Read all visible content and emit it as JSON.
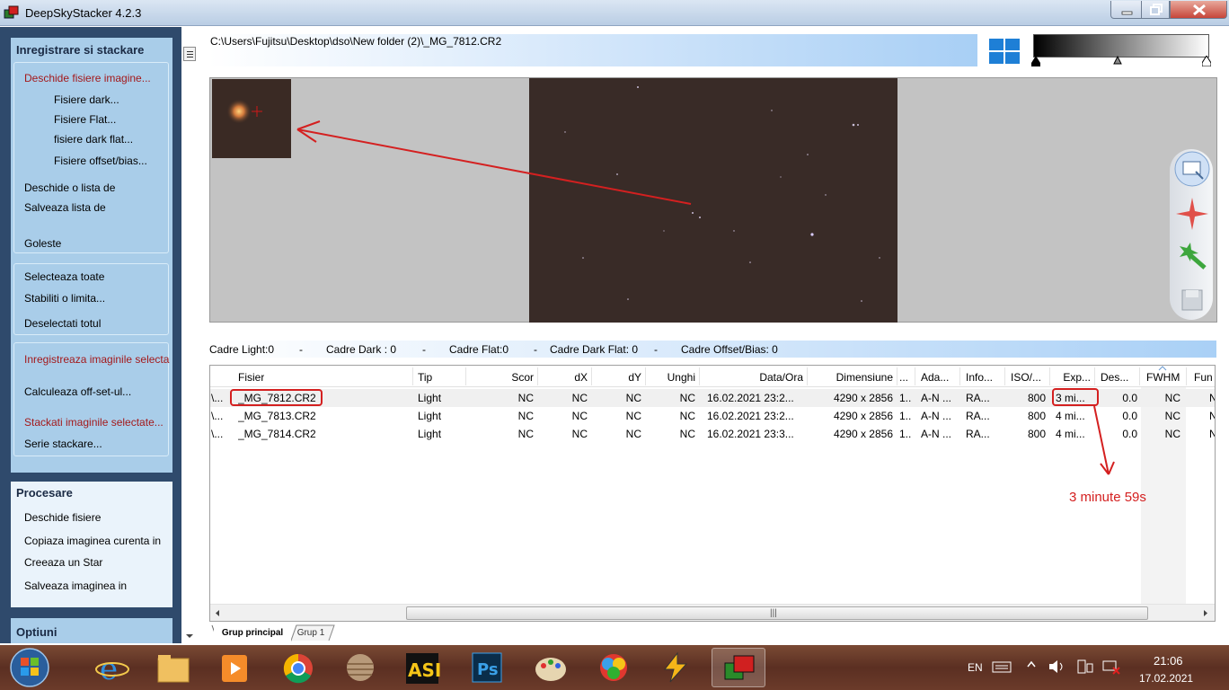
{
  "window": {
    "title": "DeepSkyStacker 4.2.3"
  },
  "left_panel": {
    "registration": {
      "title": "Inregistrare si stackare",
      "open_images": "Deschide fisiere imagine...",
      "dark_files": "Fisiere dark...",
      "flat_files": "Fisiere Flat...",
      "dark_flat_files": "fisiere dark flat...",
      "offset_files": "Fisiere offset/bias...",
      "open_list": "Deschide o lista de",
      "save_list": "Salveaza lista de",
      "clear": "Goleste",
      "select_all": "Selecteaza toate",
      "set_limit": "Stabiliti o limita...",
      "deselect_all": "Deselectati totul",
      "register_selected": "Inregistreaza imaginile selecta",
      "compute_offset": "Calculeaza off-set-ul...",
      "stack_selected": "Stackati imaginile selectate...",
      "batch_stacking": "Serie stackare..."
    },
    "processing": {
      "title": "Procesare",
      "open_files": "Deschide fisiere",
      "copy_current": "Copiaza imaginea curenta in",
      "create_star": "Creeaza un Star",
      "save_image": "Salveaza imaginea in"
    },
    "options": {
      "title": "Optiuni"
    }
  },
  "path": "C:\\Users\\Fujitsu\\Desktop\\dso\\New folder (2)\\_MG_7812.CR2",
  "counts": {
    "light": "Cadre Light:0",
    "dark": "Cadre Dark : 0",
    "flat": "Cadre Flat:0",
    "dark_flat": "Cadre Dark Flat: 0",
    "offset": "Cadre Offset/Bias: 0",
    "sep": "-"
  },
  "table": {
    "headers": {
      "path": "",
      "file": "Fisier",
      "type": "Tip",
      "score": "Scor",
      "dx": "dX",
      "dy": "dY",
      "angle": "Unghi",
      "datetime": "Data/Ora",
      "size": "Dimensiune",
      "depth": "...",
      "info_ad": "Ada...",
      "info": "Info...",
      "iso": "ISO/...",
      "exp": "Exp...",
      "des": "Des...",
      "fwhm": "FWHM",
      "fun": "Fun"
    },
    "rows": [
      {
        "path": "\\...",
        "file": "_MG_7812.CR2",
        "type": "Light",
        "score": "NC",
        "dx": "NC",
        "dy": "NC",
        "angle": "NC",
        "datetime": "16.02.2021 23:2...",
        "size": "4290 x 2856",
        "depth": "1...",
        "ad": "A-N ...",
        "info": "RA...",
        "iso": "800",
        "exp": "3 mi...",
        "des": "0.0",
        "fwhm": "NC",
        "fun": "N"
      },
      {
        "path": "\\...",
        "file": "_MG_7813.CR2",
        "type": "Light",
        "score": "NC",
        "dx": "NC",
        "dy": "NC",
        "angle": "NC",
        "datetime": "16.02.2021 23:2...",
        "size": "4290 x 2856",
        "depth": "1...",
        "ad": "A-N ...",
        "info": "RA...",
        "iso": "800",
        "exp": "4 mi...",
        "des": "0.0",
        "fwhm": "NC",
        "fun": "N"
      },
      {
        "path": "\\...",
        "file": "_MG_7814.CR2",
        "type": "Light",
        "score": "NC",
        "dx": "NC",
        "dy": "NC",
        "angle": "NC",
        "datetime": "16.02.2021 23:3...",
        "size": "4290 x 2856",
        "depth": "1...",
        "ad": "A-N ...",
        "info": "RA...",
        "iso": "800",
        "exp": "4 mi...",
        "des": "0.0",
        "fwhm": "NC",
        "fun": "N"
      }
    ]
  },
  "tabs": {
    "main": "Grup principal",
    "group1": "Grup 1"
  },
  "annotation": {
    "note": "3 minute 59s",
    "color": "#d42020"
  },
  "taskbar": {
    "apps": [
      "internet-explorer-icon",
      "folder-icon",
      "media-player-icon",
      "chrome-icon",
      "jupiter-icon",
      "asi-icon",
      "photoshop-icon",
      "paint-icon",
      "star-icon",
      "winamp-icon",
      "deepskystacker-icon"
    ],
    "lang": "EN",
    "time": "21:06",
    "date": "17.02.2021"
  }
}
